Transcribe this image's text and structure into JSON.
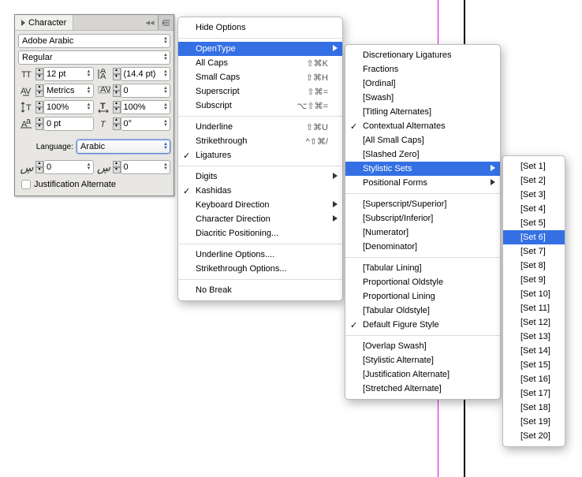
{
  "panel": {
    "title": "Character",
    "font": "Adobe Arabic",
    "weight": "Regular",
    "size": "12 pt",
    "leading": "(14.4 pt)",
    "kerning": "Metrics",
    "tracking": "0",
    "hscale": "100%",
    "vscale": "100%",
    "baseline": "0 pt",
    "skew": "0°",
    "lang_label": "Language:",
    "language": "Arabic",
    "arabic1": "0",
    "arabic2": "0",
    "justification": "Justification Alternate"
  },
  "menu1": {
    "hide_options": "Hide Options",
    "opentype": "OpenType",
    "all_caps": "All Caps",
    "all_caps_k": "⇧⌘K",
    "small_caps": "Small Caps",
    "small_caps_k": "⇧⌘H",
    "superscript": "Superscript",
    "superscript_k": "⇧⌘=",
    "subscript": "Subscript",
    "subscript_k": "⌥⇧⌘=",
    "underline": "Underline",
    "underline_k": "⇧⌘U",
    "strikethrough": "Strikethrough",
    "strikethrough_k": "^⇧⌘/",
    "ligatures": "Ligatures",
    "digits": "Digits",
    "kashidas": "Kashidas",
    "keyboard_dir": "Keyboard Direction",
    "char_dir": "Character Direction",
    "diacritic": "Diacritic Positioning...",
    "underline_opts": "Underline Options....",
    "strike_opts": "Strikethrough Options...",
    "no_break": "No Break"
  },
  "menu2": {
    "disc_lig": "Discretionary Ligatures",
    "fractions": "Fractions",
    "ordinal": "[Ordinal]",
    "swash": "[Swash]",
    "titling": "[Titling Alternates]",
    "contextual": "Contextual Alternates",
    "all_small": "[All Small Caps]",
    "slashed": "[Slashed Zero]",
    "stylistic": "Stylistic Sets",
    "positional": "Positional Forms",
    "sup_sup": "[Superscript/Superior]",
    "sub_inf": "[Subscript/Inferior]",
    "numerator": "[Numerator]",
    "denominator": "[Denominator]",
    "tab_lining": "[Tabular Lining]",
    "prop_old": "Proportional Oldstyle",
    "prop_lin": "Proportional Lining",
    "tab_old": "[Tabular Oldstyle]",
    "def_fig": "Default Figure Style",
    "overlap": "[Overlap Swash]",
    "sty_alt": "[Stylistic Alternate]",
    "just_alt": "[Justification Alternate]",
    "stretch": "[Stretched Alternate]"
  },
  "menu3": {
    "s1": "[Set 1]",
    "s2": "[Set 2]",
    "s3": "[Set 3]",
    "s4": "[Set 4]",
    "s5": "[Set 5]",
    "s6": "[Set 6]",
    "s7": "[Set 7]",
    "s8": "[Set 8]",
    "s9": "[Set 9]",
    "s10": "[Set 10]",
    "s11": "[Set 11]",
    "s12": "[Set 12]",
    "s13": "[Set 13]",
    "s14": "[Set 14]",
    "s15": "[Set 15]",
    "s16": "[Set 16]",
    "s17": "[Set 17]",
    "s18": "[Set 18]",
    "s19": "[Set 19]",
    "s20": "[Set 20]"
  }
}
